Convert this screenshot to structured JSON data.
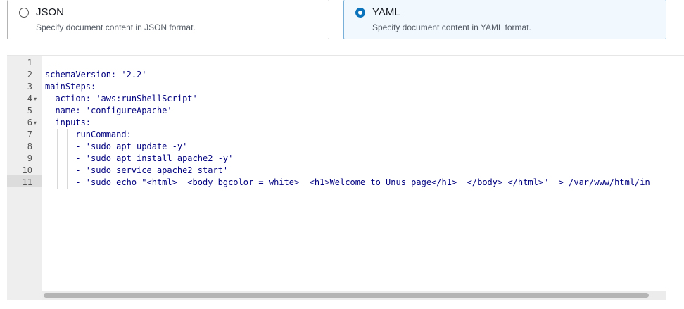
{
  "format_options": {
    "json": {
      "title": "JSON",
      "description": "Specify document content in JSON format.",
      "selected": false
    },
    "yaml": {
      "title": "YAML",
      "description": "Specify document content in YAML format.",
      "selected": true
    }
  },
  "editor": {
    "lines": [
      {
        "num": "1",
        "text": "---"
      },
      {
        "num": "2",
        "text": "schemaVersion: '2.2'"
      },
      {
        "num": "3",
        "text": "mainSteps:"
      },
      {
        "num": "4",
        "text": "- action: 'aws:runShellScript'"
      },
      {
        "num": "5",
        "text": "  name: 'configureApache'"
      },
      {
        "num": "6",
        "text": "  inputs:"
      },
      {
        "num": "7",
        "text": "      runCommand:"
      },
      {
        "num": "8",
        "text": "      - 'sudo apt update -y'"
      },
      {
        "num": "9",
        "text": "      - 'sudo apt install apache2 -y'"
      },
      {
        "num": "10",
        "text": "      - 'sudo service apache2 start'"
      },
      {
        "num": "11",
        "text": "      - 'sudo echo \"<html>  <body bgcolor = white>  <h1>Welcome to Unus page</h1>  </body> </html>\"  > /var/www/html/in"
      }
    ],
    "fold_markers": {
      "4": "▾",
      "6": "▾"
    }
  },
  "colors": {
    "accent": "#0a73bb",
    "code_text": "#000080",
    "selected_card_bg": "#f1f8fe"
  }
}
